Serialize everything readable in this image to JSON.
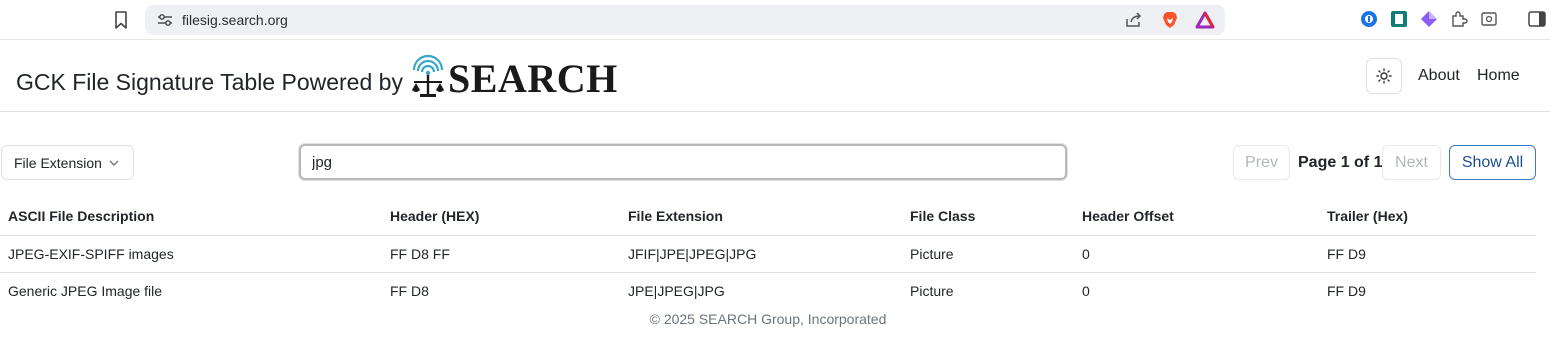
{
  "browser": {
    "url": "filesig.search.org"
  },
  "header": {
    "title": "GCK File Signature Table Powered by",
    "logo_text": "SEARCH",
    "nav": {
      "about": "About",
      "home": "Home"
    }
  },
  "toolbar": {
    "field_select": "File Extension",
    "search_value": "jpg",
    "prev_label": "Prev",
    "page_indicator": "Page 1 of 1",
    "next_label": "Next",
    "show_all_label": "Show All"
  },
  "table": {
    "columns": [
      "ASCII File Description",
      "Header (HEX)",
      "File Extension",
      "File Class",
      "Header Offset",
      "Trailer (Hex)"
    ],
    "rows": [
      [
        "JPEG-EXIF-SPIFF images",
        "FF D8 FF",
        "JFIF|JPE|JPEG|JPG",
        "Picture",
        "0",
        "FF D9"
      ],
      [
        "Generic JPEG Image file",
        "FF D8",
        "JPE|JPEG|JPG",
        "Picture",
        "0",
        "FF D9"
      ]
    ]
  },
  "footer": {
    "copyright": "© 2025 SEARCH Group, Incorporated"
  }
}
